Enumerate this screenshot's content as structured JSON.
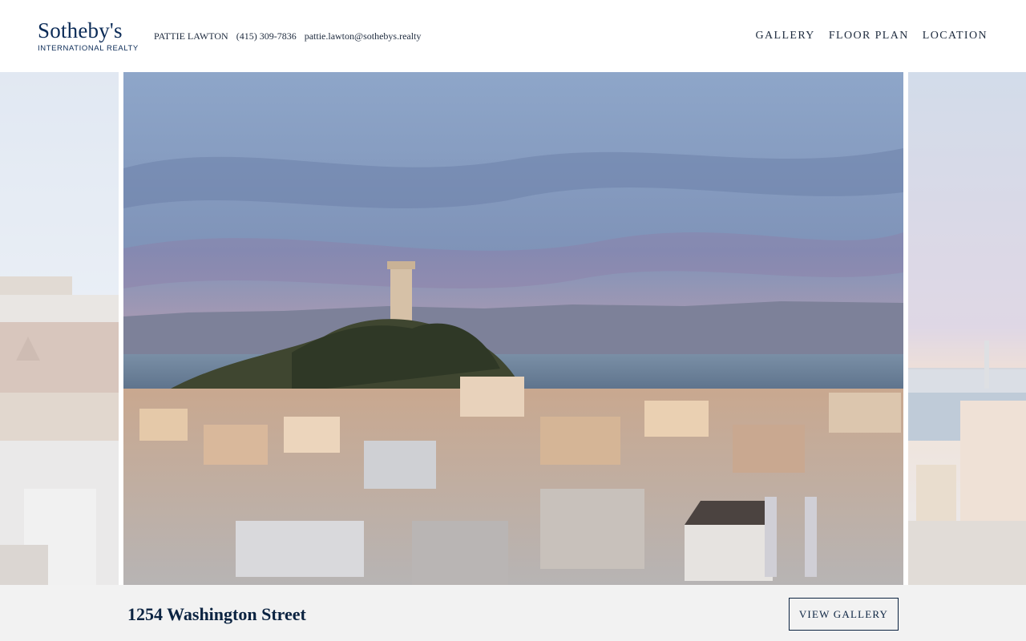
{
  "header": {
    "logo": {
      "main": "Sotheby's",
      "sub": "INTERNATIONAL REALTY"
    },
    "contact": {
      "name": "PATTIE LAWTON",
      "phone": "(415) 309-7836",
      "email": "pattie.lawton@sothebys.realty"
    },
    "nav": [
      {
        "label": "GALLERY"
      },
      {
        "label": "FLOOR PLAN"
      },
      {
        "label": "LOCATION"
      }
    ]
  },
  "carousel": {
    "slides": [
      {
        "description_icon": "previous-slide-photo"
      },
      {
        "description_icon": "current-slide-photo"
      },
      {
        "description_icon": "next-slide-photo"
      }
    ]
  },
  "listing": {
    "address": "1254 Washington Street",
    "view_gallery_label": "VIEW GALLERY"
  },
  "colors": {
    "brand_navy": "#0b2b57",
    "bar_background": "#f2f2f2"
  }
}
